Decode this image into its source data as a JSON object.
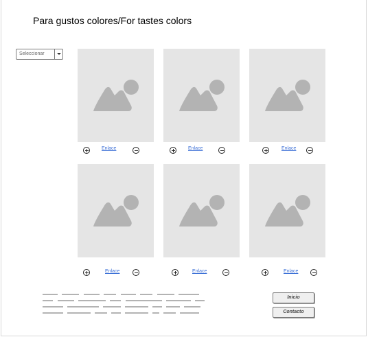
{
  "page": {
    "title": "Para gustos colores/For tastes colors"
  },
  "dropdown": {
    "selected": "Seleccionar"
  },
  "gallery": {
    "items": [
      {
        "link": "Enlace",
        "icon": "image-placeholder-icon"
      },
      {
        "link": "Enlace",
        "icon": "image-placeholder-icon"
      },
      {
        "link": "Enlace",
        "icon": "image-placeholder-icon"
      },
      {
        "link": "Enlace",
        "icon": "image-placeholder-icon"
      },
      {
        "link": "Enlace",
        "icon": "image-placeholder-icon"
      },
      {
        "link": "Enlace",
        "icon": "image-placeholder-icon"
      }
    ]
  },
  "buttons": {
    "home": "Inicio",
    "contact": "Contacto"
  },
  "colors": {
    "placeholder_bg": "#e5e5e5",
    "placeholder_icon": "#b3b3b3",
    "link": "#3b6fd6"
  }
}
